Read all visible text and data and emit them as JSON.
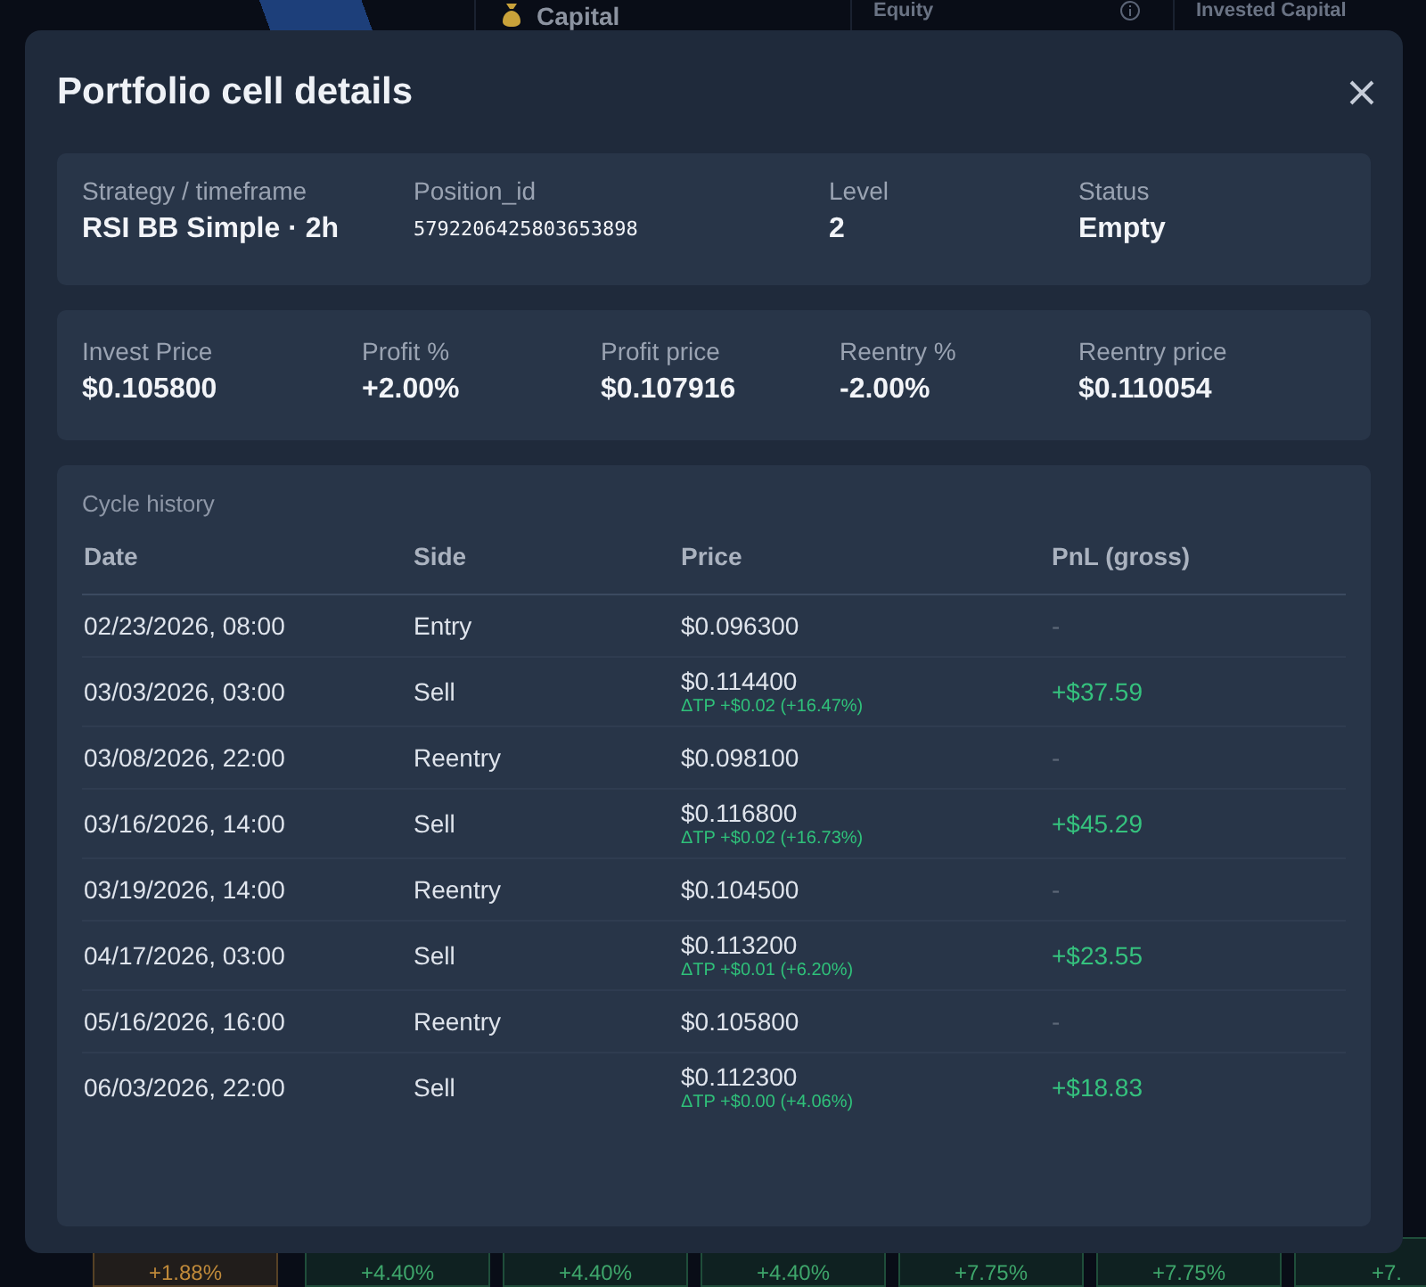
{
  "background": {
    "top_cards": [
      {
        "kind": "icon",
        "title": "Capital"
      },
      {
        "kind": "info",
        "title": "Equity"
      },
      {
        "kind": "plain",
        "title": "Invested Capital"
      }
    ],
    "bottom_cells": [
      {
        "text": "+1.88%",
        "color": "#c08a3a"
      },
      {
        "text": "+4.40%",
        "color": "#3ea66b"
      },
      {
        "text": "+4.40%",
        "color": "#3ea66b"
      },
      {
        "text": "+4.40%",
        "color": "#3ea66b"
      },
      {
        "text": "+7.75%",
        "color": "#3ea66b"
      },
      {
        "text": "+7.75%",
        "color": "#3ea66b"
      },
      {
        "text": "+7.",
        "color": "#3ea66b"
      }
    ]
  },
  "modal": {
    "title": "Portfolio cell details",
    "summary": [
      {
        "label": "Strategy / timeframe",
        "value": "RSI BB Simple · 2h",
        "kind": "text"
      },
      {
        "label": "Position_id",
        "value": "5792206425803653898",
        "kind": "mono"
      },
      {
        "label": "Level",
        "value": "2",
        "kind": "text"
      },
      {
        "label": "Status",
        "value": "Empty",
        "kind": "text"
      }
    ],
    "prices": [
      {
        "label": "Invest Price",
        "value": "$0.105800"
      },
      {
        "label": "Profit %",
        "value": "+2.00%"
      },
      {
        "label": "Profit price",
        "value": "$0.107916"
      },
      {
        "label": "Reentry %",
        "value": "-2.00%"
      },
      {
        "label": "Reentry price",
        "value": "$0.110054"
      }
    ],
    "history": {
      "title": "Cycle history",
      "columns": [
        "Date",
        "Side",
        "Price",
        "PnL (gross)"
      ],
      "rows": [
        {
          "kind": "entry",
          "date": "02/23/2026, 08:00",
          "side": "Entry",
          "price": "$0.096300",
          "pnl": "-"
        },
        {
          "kind": "sell",
          "date": "03/03/2026, 03:00",
          "side": "Sell",
          "price": "$0.114400",
          "note": "ΔTP +$0.02 (+16.47%)",
          "pnl": "+$37.59"
        },
        {
          "kind": "entry",
          "date": "03/08/2026, 22:00",
          "side": "Reentry",
          "price": "$0.098100",
          "pnl": "-"
        },
        {
          "kind": "sell",
          "date": "03/16/2026, 14:00",
          "side": "Sell",
          "price": "$0.116800",
          "note": "ΔTP +$0.02 (+16.73%)",
          "pnl": "+$45.29"
        },
        {
          "kind": "entry",
          "date": "03/19/2026, 14:00",
          "side": "Reentry",
          "price": "$0.104500",
          "pnl": "-"
        },
        {
          "kind": "sell",
          "date": "04/17/2026, 03:00",
          "side": "Sell",
          "price": "$0.113200",
          "note": "ΔTP +$0.01 (+6.20%)",
          "pnl": "+$23.55"
        },
        {
          "kind": "entry",
          "date": "05/16/2026, 16:00",
          "side": "Reentry",
          "price": "$0.105800",
          "pnl": "-"
        },
        {
          "kind": "sell",
          "date": "06/03/2026, 22:00",
          "side": "Sell",
          "price": "$0.112300",
          "note": "ΔTP +$0.00 (+4.06%)",
          "pnl": "+$18.83"
        }
      ]
    }
  }
}
